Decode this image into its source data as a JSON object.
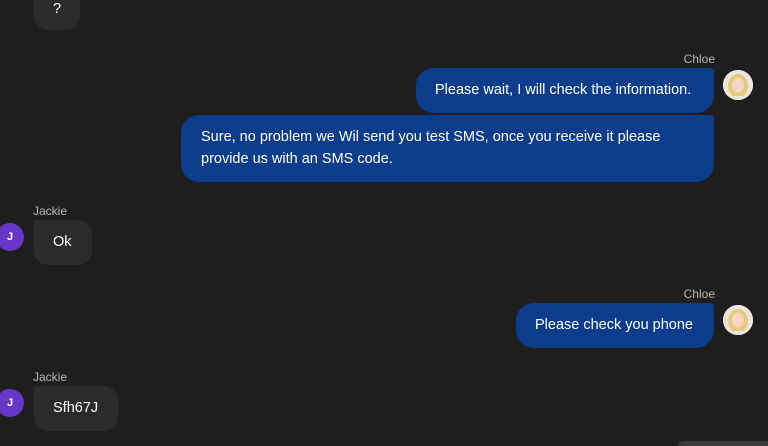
{
  "messages": {
    "m0": {
      "text": "?"
    },
    "m1": {
      "sender": "Chloe",
      "text": "Please wait, I will check the information."
    },
    "m2": {
      "text": "Sure, no problem we Wil send you test SMS, once you receive it please provide us with an SMS code."
    },
    "m3": {
      "sender": "Jackie",
      "avatar_initial": "J",
      "text": "Ok"
    },
    "m4": {
      "sender": "Chloe",
      "text": "Please check you phone"
    },
    "m5": {
      "sender": "Jackie",
      "avatar_initial": "J",
      "text": "Sfh67J"
    }
  },
  "colors": {
    "background": "#1e1e1f",
    "incoming_bubble": "#2b2b2d",
    "outgoing_bubble": "#0c3d8c",
    "avatar_jackie": "#6a35c9"
  },
  "icons": {
    "chloe_avatar": "chloe-avatar-photo",
    "jackie_avatar": "jackie-initial-avatar"
  }
}
